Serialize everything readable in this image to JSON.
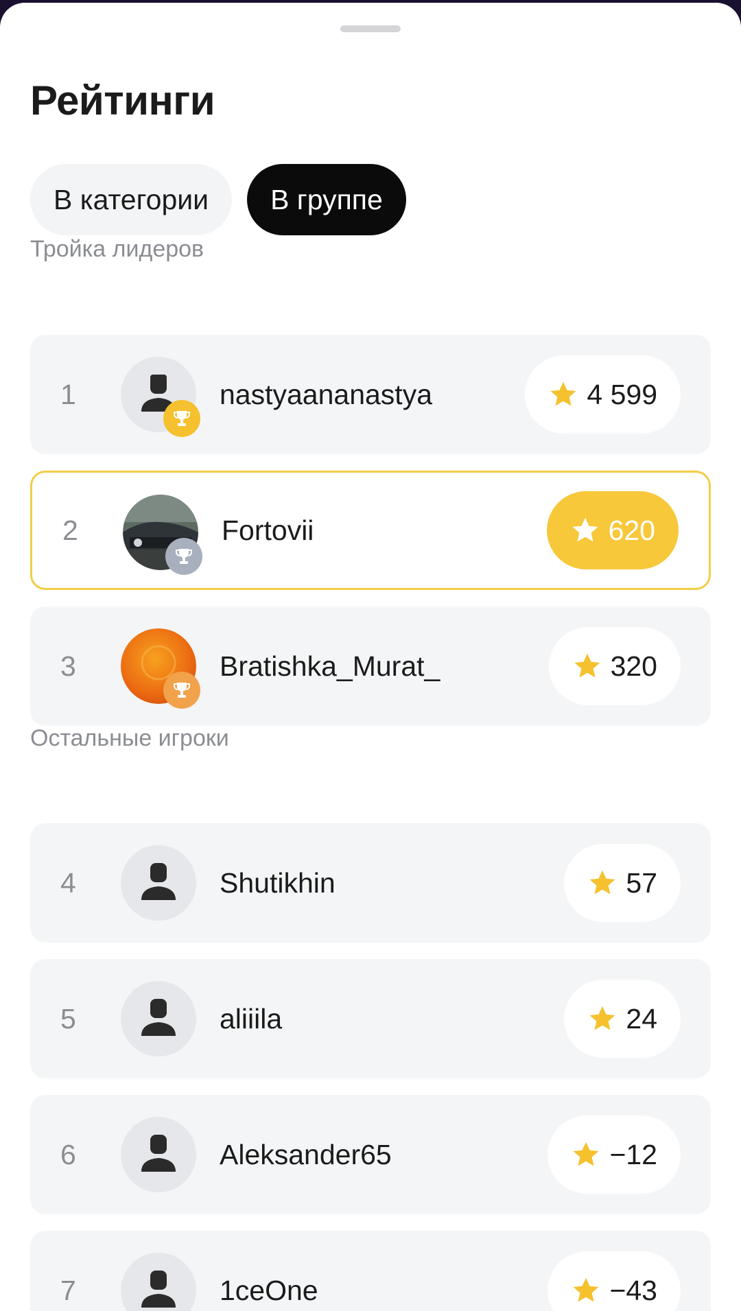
{
  "title": "Рейтинги",
  "tabs": [
    {
      "label": "В категории",
      "active": false
    },
    {
      "label": "В группе",
      "active": true
    }
  ],
  "leaders": {
    "label": "Тройка лидеров",
    "rows": [
      {
        "rank": "1",
        "name": "nastyaananastya",
        "score": "4 599",
        "avatar": "default-avatar",
        "badge": "gold-trophy-badge"
      },
      {
        "rank": "2",
        "name": "Fortovii",
        "score": "620",
        "avatar": "car-photo",
        "badge": "silver-trophy-badge",
        "highlighted": true
      },
      {
        "rank": "3",
        "name": "Bratishka_Murat_",
        "score": "320",
        "avatar": "orange-pattern-photo",
        "badge": "bronze-trophy-badge"
      }
    ]
  },
  "others": {
    "label": "Остальные игроки",
    "rows": [
      {
        "rank": "4",
        "name": "Shutikhin",
        "score": "57",
        "avatar": "default-avatar"
      },
      {
        "rank": "5",
        "name": "aliiila",
        "score": "24",
        "avatar": "default-avatar"
      },
      {
        "rank": "6",
        "name": "Aleksander65",
        "score": "−12",
        "avatar": "default-avatar"
      },
      {
        "rank": "7",
        "name": "1ceOne",
        "score": "−43",
        "avatar": "default-avatar"
      }
    ]
  },
  "colors": {
    "accent_yellow": "#f8c83b",
    "highlight_border": "#f3cd45",
    "gold": "#f5c12e",
    "silver": "#a9b0bd",
    "bronze": "#f1a24a",
    "active_tab": "#0b0b0b"
  },
  "icons": {
    "score": "star-icon",
    "trophy": "trophy-icon",
    "avatar_default": "person-icon"
  }
}
